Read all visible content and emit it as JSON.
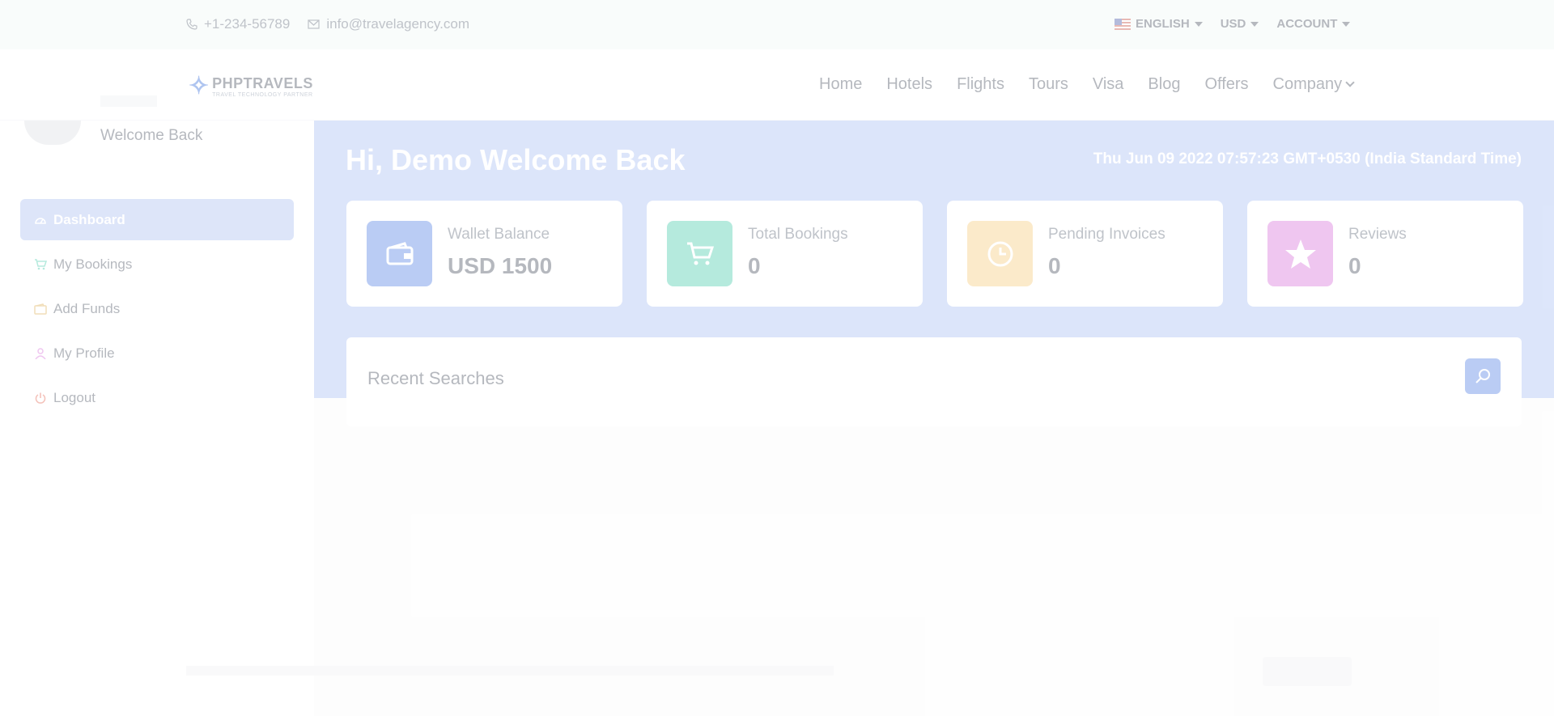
{
  "topbar": {
    "phone": "+1-234-56789",
    "email": "info@travelagency.com",
    "language": "ENGLISH",
    "currency": "USD",
    "account": "ACCOUNT"
  },
  "navbar": {
    "logo_name": "PHPTRAVELS",
    "logo_tagline": "TRAVEL TECHNOLOGY PARTNER",
    "menu": [
      "Home",
      "Hotels",
      "Flights",
      "Tours",
      "Visa",
      "Blog",
      "Offers",
      "Company"
    ]
  },
  "sidebar": {
    "welcome": "Welcome Back",
    "items": [
      {
        "label": "Dashboard",
        "icon": "dashboard-icon"
      },
      {
        "label": "My Bookings",
        "icon": "cart-icon"
      },
      {
        "label": "Add Funds",
        "icon": "wallet-icon"
      },
      {
        "label": "My Profile",
        "icon": "user-icon"
      },
      {
        "label": "Logout",
        "icon": "power-icon"
      }
    ]
  },
  "main": {
    "greeting": "Hi, Demo Welcome Back",
    "datetime": "Thu Jun 09 2022 07:57:23 GMT+0530 (India Standard Time)",
    "cards": [
      {
        "label": "Wallet Balance",
        "value": "USD 1500",
        "icon": "wallet-icon",
        "color": "#3b6fe0"
      },
      {
        "label": "Total Bookings",
        "value": "0",
        "icon": "cart-icon",
        "color": "#2ec4a0"
      },
      {
        "label": "Pending Invoices",
        "value": "0",
        "icon": "clock-icon",
        "color": "#f6c56b"
      },
      {
        "label": "Reviews",
        "value": "0",
        "icon": "star-icon",
        "color": "#d35fd6"
      }
    ],
    "recent_searches_title": "Recent Searches"
  },
  "colors": {
    "band": "#9db6f3",
    "accent": "#3b6fe0"
  }
}
